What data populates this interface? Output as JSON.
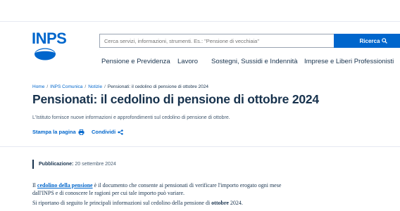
{
  "brand": {
    "logo_text": "INPS",
    "accent": "#0066cc",
    "text_dark": "#17324d"
  },
  "search": {
    "placeholder": "Cerca servizi, informazioni, strumenti. Es.: \"Pensione di vecchiaia\"",
    "button_label": "Ricerca",
    "button_icon": "search-icon"
  },
  "nav": {
    "items": [
      {
        "label": "Pensione e Previdenza"
      },
      {
        "label": "Lavoro"
      },
      {
        "label": "Sostegni, Sussidi e Indennità"
      },
      {
        "label": "Imprese e Liberi Professionisti"
      }
    ]
  },
  "breadcrumb": {
    "items": [
      {
        "label": "Home"
      },
      {
        "label": "INPS Comunica"
      },
      {
        "label": "Notizie"
      }
    ],
    "current": "Pensionati: il cedolino di pensione di ottobre 2024"
  },
  "article": {
    "title": "Pensionati: il cedolino di pensione di ottobre 2024",
    "subtitle": "L'Istituto fornisce nuove informazioni e approfondimenti sul cedolino di pensione di ottobre.",
    "print_label": "Stampa la pagina",
    "print_icon": "printer-icon",
    "share_label": "Condividi",
    "share_icon": "share-icon",
    "published_label": "Pubblicazione:",
    "published_date": "20 settembre 2024",
    "p1_prefix": "Il ",
    "p1_link": "cedolino della pensione",
    "p1_suffix": " è il documento che consente ai pensionati di verificare l'importo erogato ogni mese",
    "p1_line2": "dall'INPS e di conoscere le ragioni per cui tale importo può variare.",
    "p2_prefix": "Si riportano di seguito le principali informazioni sul cedolino della pensione di ",
    "p2_bold": "ottobre",
    "p2_suffix": " 2024."
  }
}
